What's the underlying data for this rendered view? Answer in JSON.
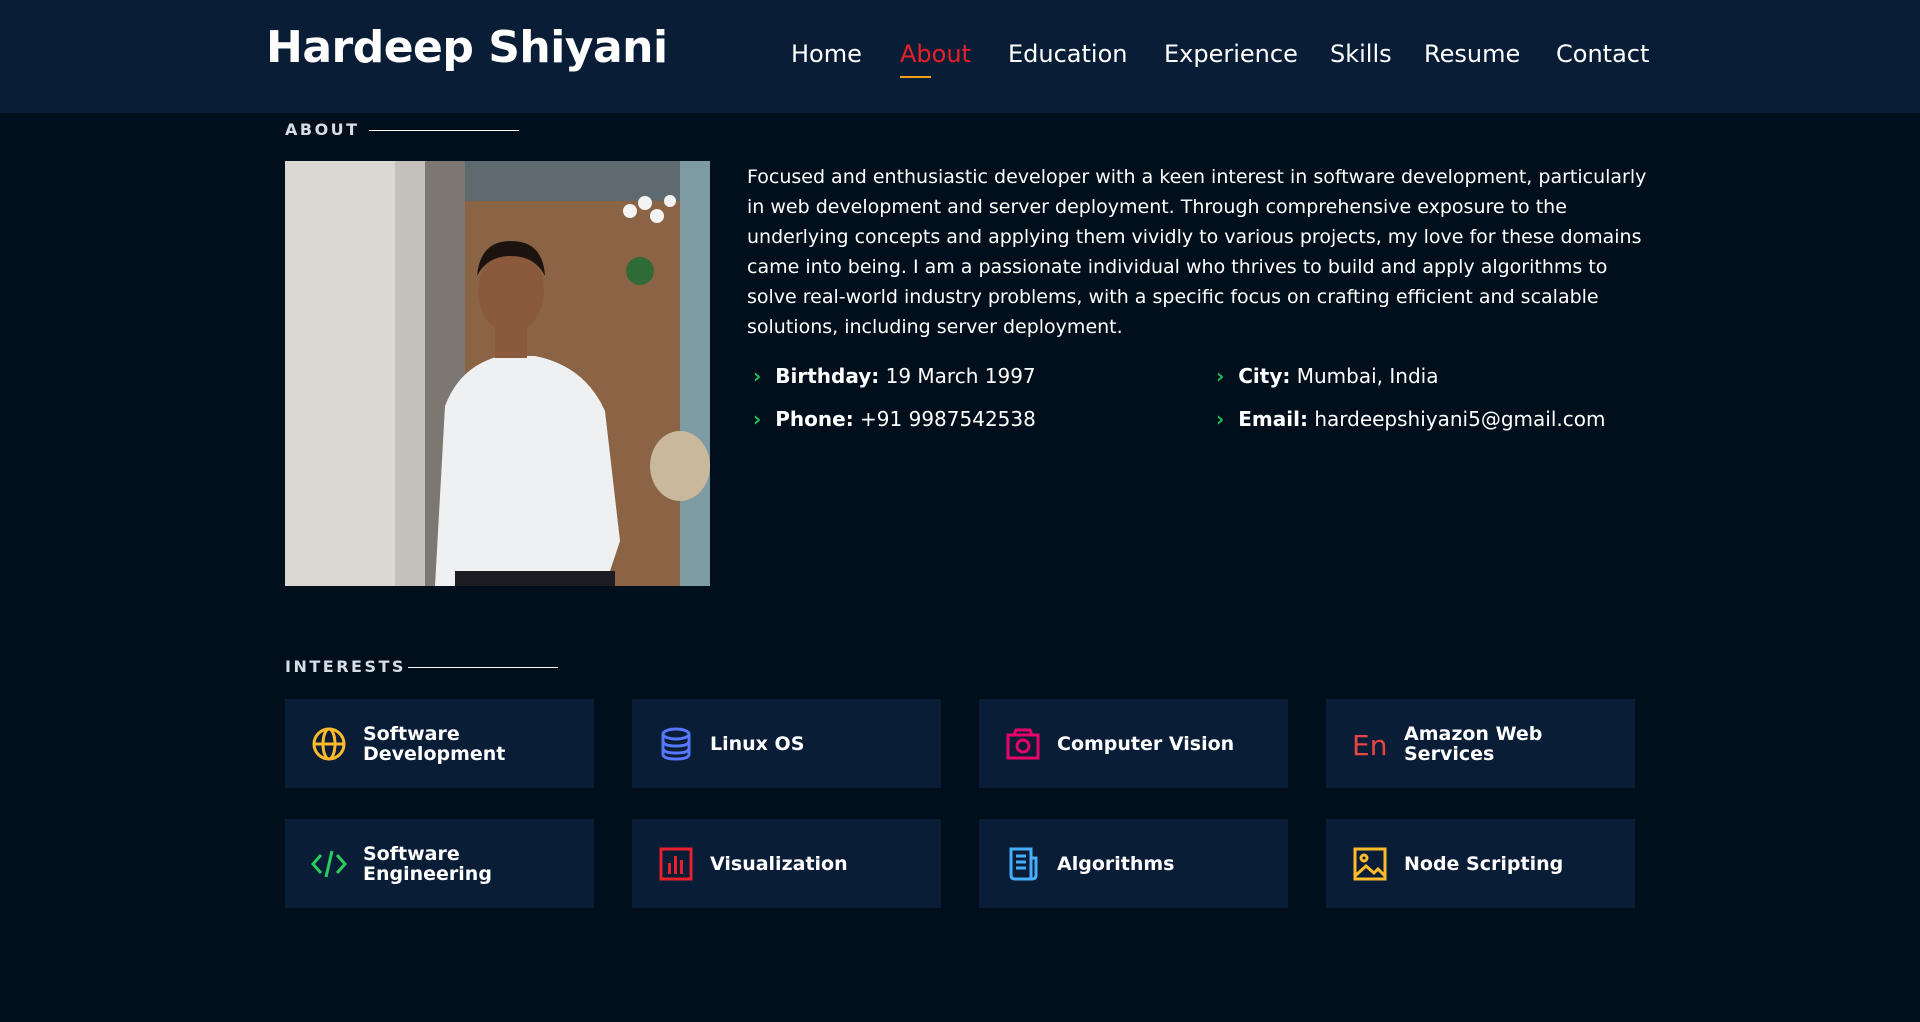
{
  "header": {
    "logo": "Hardeep Shiyani",
    "nav": [
      "Home",
      "About",
      "Education",
      "Experience",
      "Skills",
      "Resume",
      "Contact"
    ],
    "active_nav": "About"
  },
  "about": {
    "section_title": "ABOUT",
    "description": "Focused and enthusiastic developer with a keen interest in software development, particularly in web development and server deployment. Through comprehensive exposure to the underlying concepts and applying them vividly to various projects, my love for these domains came into being. I am a passionate individual who thrives to build and apply algorithms to solve real-world industry problems, with a specific focus on crafting efficient and scalable solutions, including server deployment.",
    "details": {
      "birthday_label": "Birthday:",
      "birthday_value": "19 March 1997",
      "city_label": "City:",
      "city_value": "Mumbai, India",
      "phone_label": "Phone:",
      "phone_value": "+91 9987542538",
      "email_label": "Email:",
      "email_value": "hardeepshiyani5@gmail.com"
    }
  },
  "interests": {
    "section_title": "INTERESTS",
    "items": [
      {
        "label": "Software Development",
        "icon": "globe-icon",
        "color": "#ffbb2c"
      },
      {
        "label": "Linux OS",
        "icon": "database-icon",
        "color": "#5578ff"
      },
      {
        "label": "Computer Vision",
        "icon": "camera-icon",
        "color": "#e80368"
      },
      {
        "label": "Amazon Web Services",
        "icon": "translate-icon",
        "color": "#e361ff"
      },
      {
        "label": "Software Engineering",
        "icon": "code-icon",
        "color": "#29cc61"
      },
      {
        "label": "Visualization",
        "icon": "bar-chart-icon",
        "color": "#e8202c"
      },
      {
        "label": "Algorithms",
        "icon": "document-icon",
        "color": "#47aeff"
      },
      {
        "label": "Node Scripting",
        "icon": "image-icon",
        "color": "#ffa76e"
      }
    ]
  },
  "colors": {
    "background": "#010e1b",
    "header_bg": "#0a1d36",
    "accent_red": "#e8202c",
    "chevron_green": "#19c25a"
  }
}
